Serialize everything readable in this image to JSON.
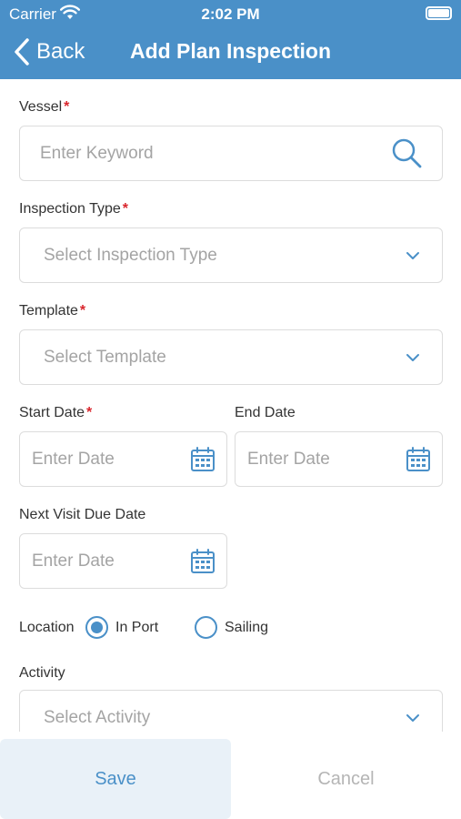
{
  "status_bar": {
    "carrier": "Carrier",
    "time": "2:02 PM"
  },
  "nav": {
    "back_label": "Back",
    "title": "Add Plan Inspection"
  },
  "form": {
    "vessel": {
      "label": "Vessel",
      "placeholder": "Enter Keyword",
      "required": "*"
    },
    "inspection_type": {
      "label": "Inspection Type",
      "placeholder": "Select Inspection Type",
      "required": "*"
    },
    "template": {
      "label": "Template",
      "placeholder": "Select Template",
      "required": "*"
    },
    "start_date": {
      "label": "Start Date",
      "placeholder": "Enter Date",
      "required": "*"
    },
    "end_date": {
      "label": "End Date",
      "placeholder": "Enter Date"
    },
    "next_visit_due_date": {
      "label": "Next Visit Due Date",
      "placeholder": "Enter Date"
    },
    "location": {
      "label": "Location",
      "options": [
        {
          "label": "In Port",
          "selected": true
        },
        {
          "label": "Sailing",
          "selected": false
        }
      ]
    },
    "activity": {
      "label": "Activity",
      "placeholder": "Select Activity"
    }
  },
  "footer": {
    "save_label": "Save",
    "cancel_label": "Cancel"
  },
  "colors": {
    "accent": "#4a90c8",
    "required": "#d9262d",
    "placeholder": "#a4a4a4"
  }
}
